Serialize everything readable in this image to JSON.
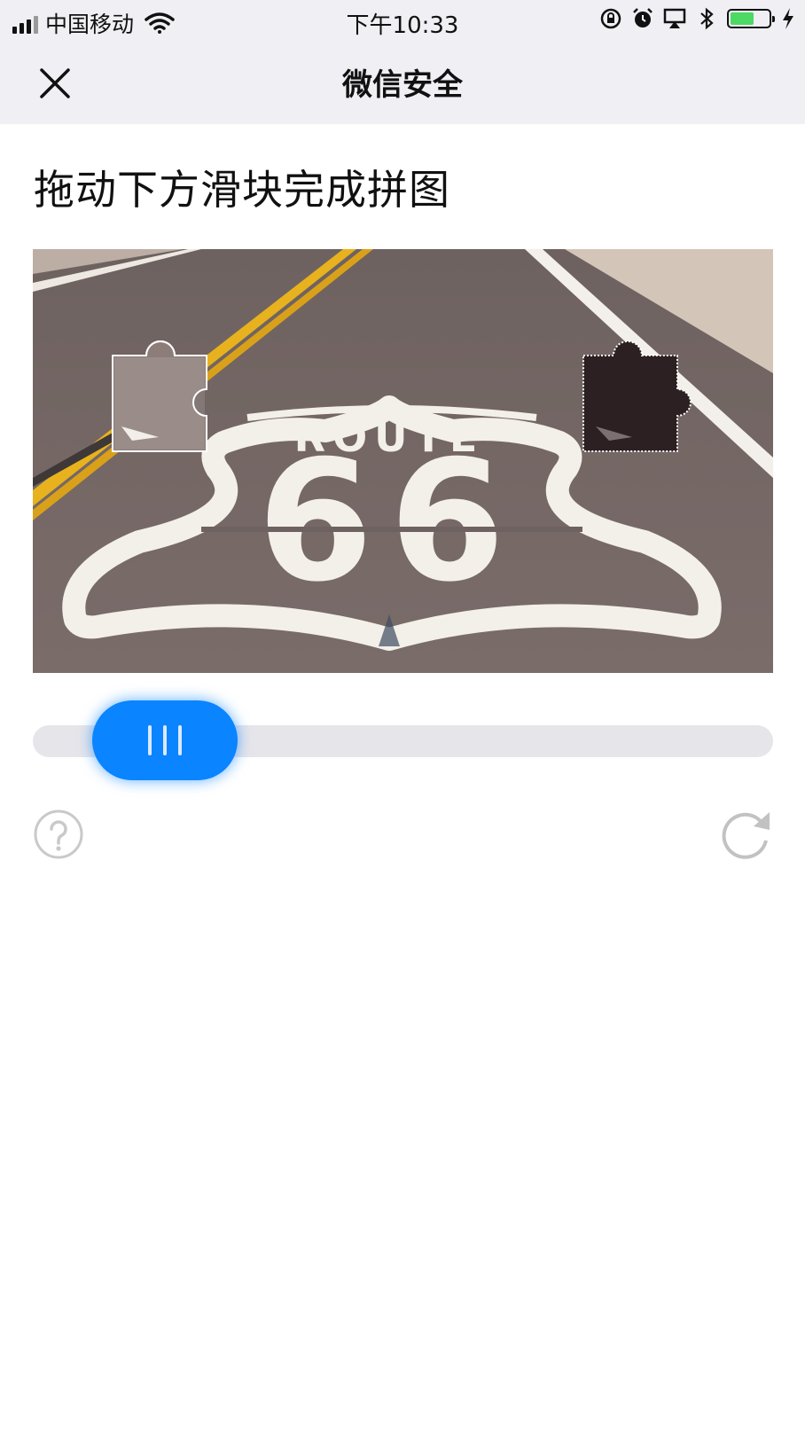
{
  "status_bar": {
    "carrier": "中国移动",
    "time": "下午10:33",
    "battery_level": 0.62,
    "icons": [
      "signal-icon",
      "wifi-icon",
      "orientation-lock-icon",
      "alarm-icon",
      "airplay-icon",
      "bluetooth-icon",
      "battery-icon",
      "charging-bolt-icon"
    ]
  },
  "nav": {
    "title": "微信安全",
    "close_icon": "close-icon"
  },
  "captcha": {
    "instruction": "拖动下方滑块完成拼图",
    "image_text": "ROUTE 66",
    "slider_progress": 0.08,
    "help_icon": "help-icon",
    "refresh_icon": "refresh-icon",
    "accent_color": "#0a84ff"
  }
}
